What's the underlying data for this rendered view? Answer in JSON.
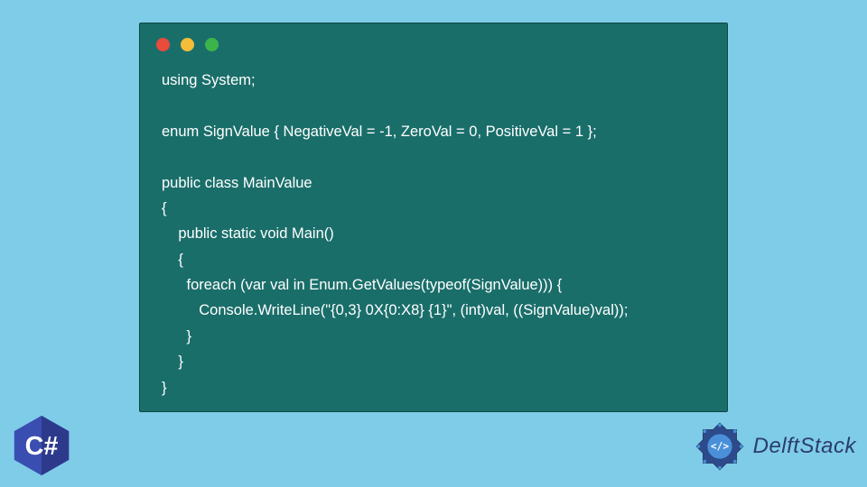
{
  "code": {
    "line1": "using System;",
    "line2": "",
    "line3": "enum SignValue { NegativeVal = -1, ZeroVal = 0, PositiveVal = 1 };",
    "line4": "",
    "line5": "public class MainValue",
    "line6": "{",
    "line7": "    public static void Main()",
    "line8": "    {",
    "line9": "      foreach (var val in Enum.GetValues(typeof(SignValue))) {",
    "line10": "         Console.WriteLine(\"{0,3} 0X{0:X8} {1}\", (int)val, ((SignValue)val));",
    "line11": "      }",
    "line12": "    }",
    "line13": "}"
  },
  "badge": {
    "language": "C#"
  },
  "brand": {
    "name": "DelftStack"
  }
}
